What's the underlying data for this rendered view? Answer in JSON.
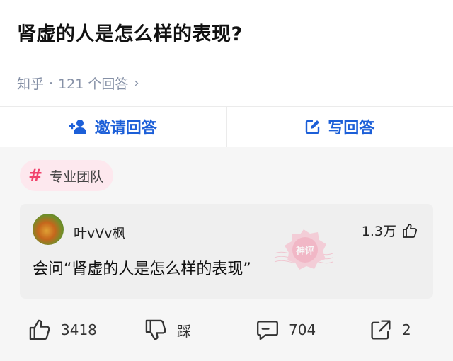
{
  "question": {
    "title": "肾虚的人是怎么样的表现?",
    "source": "知乎",
    "separator": "·",
    "answer_count": "121 个回答",
    "chevron": "›"
  },
  "actions": {
    "invite_label": "邀请回答",
    "write_label": "写回答"
  },
  "topic": {
    "hash": "#",
    "label": "专业团队"
  },
  "comment": {
    "username": "叶vVv枫",
    "likes": "1.3万",
    "text": "会问“肾虚的人是怎么样的表现”",
    "stamp_text": "神评"
  },
  "bottom_bar": {
    "upvotes": "3418",
    "downvote_label": "踩",
    "comments": "704",
    "share_partial": "2"
  },
  "colors": {
    "accent_blue": "#1c5fd8",
    "topic_pink": "#f1426c",
    "meta_gray": "#8590a6"
  }
}
